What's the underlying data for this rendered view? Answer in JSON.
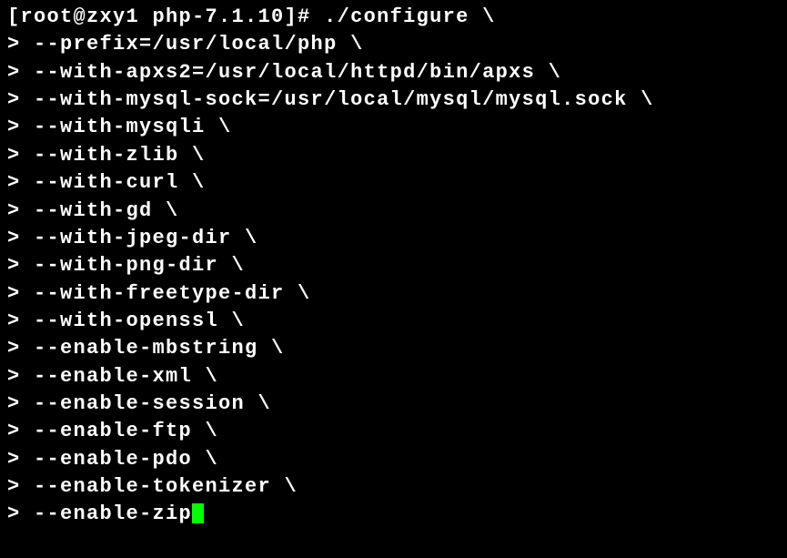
{
  "terminal": {
    "prompt": "[root@zxy1 php-7.1.10]# ",
    "command": "./configure \\",
    "continuation_prompt": "> ",
    "lines": [
      "--prefix=/usr/local/php \\",
      "--with-apxs2=/usr/local/httpd/bin/apxs \\",
      "--with-mysql-sock=/usr/local/mysql/mysql.sock \\",
      "--with-mysqli \\",
      "--with-zlib \\",
      "--with-curl \\",
      "--with-gd \\",
      "--with-jpeg-dir \\",
      "--with-png-dir \\",
      "--with-freetype-dir \\",
      "--with-openssl \\",
      "--enable-mbstring \\",
      "--enable-xml \\",
      "--enable-session \\",
      "--enable-ftp \\",
      "--enable-pdo \\",
      "--enable-tokenizer \\",
      "--enable-zip"
    ]
  }
}
